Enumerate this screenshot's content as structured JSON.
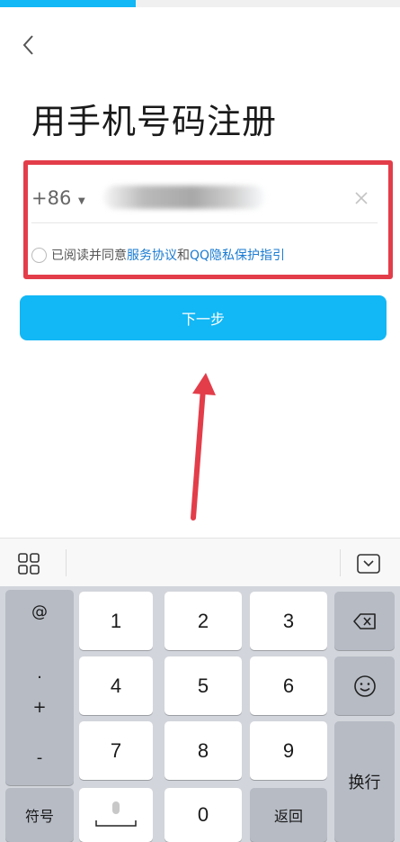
{
  "progress": {
    "fraction": 0.34,
    "color": "#12b7f5"
  },
  "title": "用手机号码注册",
  "phone": {
    "country_code": "+86",
    "value": ""
  },
  "agreement": {
    "prefix": "已阅读并同意",
    "service_link": "服务协议",
    "and": "和",
    "privacy_link": "QQ隐私保护指引"
  },
  "next_button": "下一步",
  "keyboard": {
    "side_symbols": [
      "@",
      ".",
      "+",
      "-"
    ],
    "digits": [
      "1",
      "2",
      "3",
      "4",
      "5",
      "6",
      "7",
      "8",
      "9",
      "0"
    ],
    "symbols_key": "符号",
    "return_key": "返回",
    "enter_key": "换行"
  },
  "colors": {
    "accent": "#12b7f5",
    "highlight": "#e33d4a",
    "link": "#1a7bd1"
  }
}
